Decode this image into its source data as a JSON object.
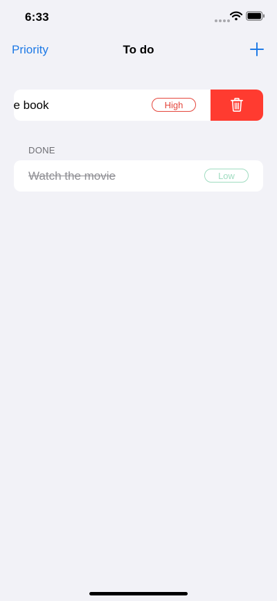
{
  "status_bar": {
    "time": "6:33"
  },
  "nav": {
    "left_label": "Priority",
    "title": "To do",
    "add_icon": "plus-icon"
  },
  "todo_items": [
    {
      "title": "Read the book",
      "visible_text": "he book",
      "priority": "High",
      "priority_color": "#e4443a",
      "swiped": true,
      "delete_icon": "trash-icon",
      "delete_color": "#ff3b30"
    }
  ],
  "done_section": {
    "header": "DONE",
    "items": [
      {
        "title": "Watch the movie",
        "priority": "Low",
        "priority_color": "#9fdcc0",
        "completed": true
      }
    ]
  },
  "colors": {
    "accent": "#1e7ae6",
    "background": "#f2f2f7"
  }
}
